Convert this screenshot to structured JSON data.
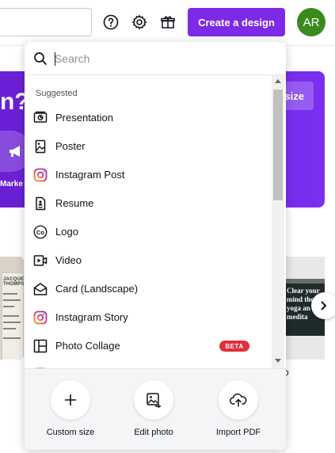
{
  "header": {
    "create_label": "Create a design",
    "avatar_initials": "AR",
    "help_icon": "help-circle-icon",
    "settings_icon": "gear-icon",
    "gift_icon": "gift-icon"
  },
  "background": {
    "hero_title": "n?",
    "resize_label": "size",
    "market_label": "Marke",
    "doc_title": "JACQUELI\nTHOMPSO",
    "promo_text": "Clear your mind the yoga an medita",
    "caption": "o"
  },
  "dropdown": {
    "search_placeholder": "Search",
    "section_label": "Suggested",
    "items": [
      {
        "label": "Presentation",
        "icon": "presentation-icon"
      },
      {
        "label": "Poster",
        "icon": "poster-icon"
      },
      {
        "label": "Instagram Post",
        "icon": "instagram-icon"
      },
      {
        "label": "Resume",
        "icon": "resume-icon"
      },
      {
        "label": "Logo",
        "icon": "logo-co-icon"
      },
      {
        "label": "Video",
        "icon": "video-icon"
      },
      {
        "label": "Card (Landscape)",
        "icon": "card-envelope-icon"
      },
      {
        "label": "Instagram Story",
        "icon": "instagram-icon"
      },
      {
        "label": "Photo Collage",
        "icon": "collage-icon"
      }
    ],
    "actions": [
      {
        "label": "Custom size",
        "icon": "plus-icon"
      },
      {
        "label": "Edit photo",
        "icon": "image-edit-icon"
      },
      {
        "label": "Import PDF",
        "icon": "upload-cloud-icon",
        "badge": "BETA"
      }
    ]
  },
  "colors": {
    "accent": "#7d2ae8",
    "avatar": "#3b8a1f",
    "badge": "#e02e3d"
  }
}
